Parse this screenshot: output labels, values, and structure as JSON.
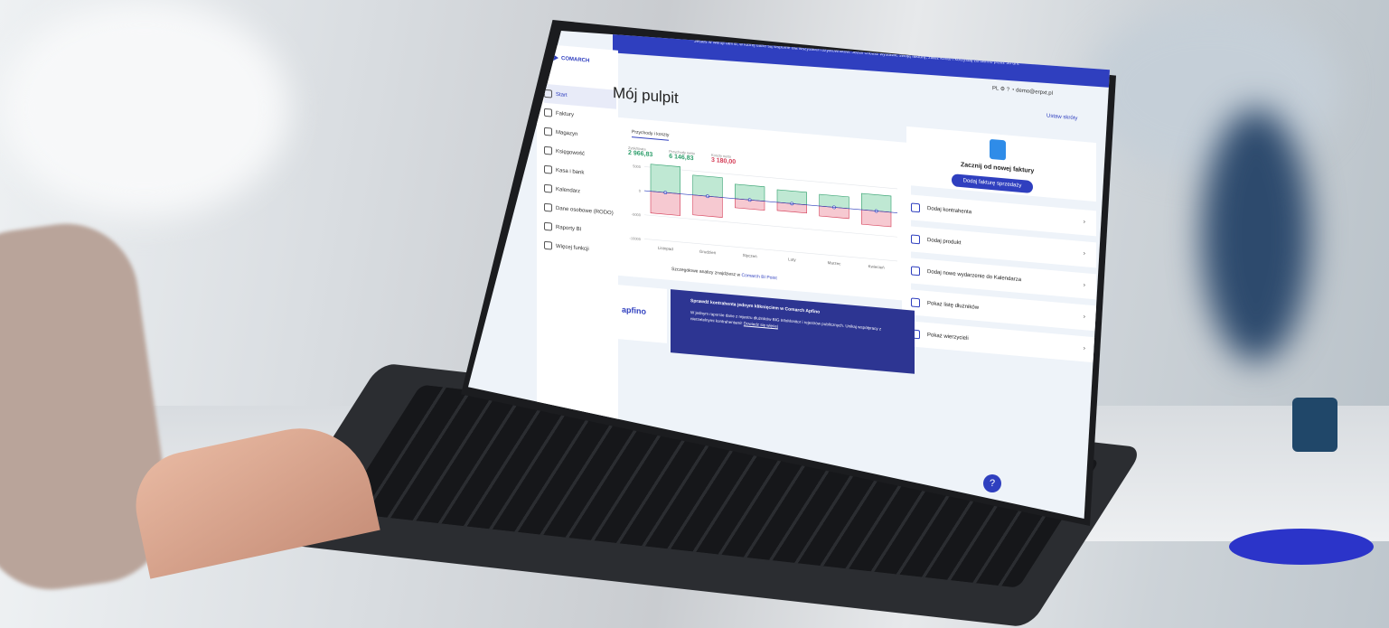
{
  "banner": {
    "text": "Jesteś w wersji demo, w której dane są wspólne dla wszystkich użytkowników. Jeżeli chcesz wystawić swoją fakturę, załóż konto i korzystaj za darmo przez 30 dni."
  },
  "app": {
    "logo_line1": "COMARCH",
    "logo_line2": "ERP XT"
  },
  "header": {
    "title": "Mój pulpit",
    "lang": "PL",
    "user": "demo@erpxt.pl",
    "set_tiles": "Ustaw skróty"
  },
  "sidebar": {
    "items": [
      {
        "label": "Start",
        "icon": "home-icon"
      },
      {
        "label": "Faktury",
        "icon": "invoice-icon"
      },
      {
        "label": "Magazyn",
        "icon": "warehouse-icon"
      },
      {
        "label": "Księgowość",
        "icon": "accounting-icon"
      },
      {
        "label": "Kasa i bank",
        "icon": "bank-icon"
      },
      {
        "label": "Kalendarz",
        "icon": "calendar-icon"
      },
      {
        "label": "Dane osobowe (RODO)",
        "icon": "person-icon"
      },
      {
        "label": "Raporty BI",
        "icon": "reports-icon"
      },
      {
        "label": "Więcej funkcji",
        "icon": "more-icon"
      }
    ]
  },
  "chart_card": {
    "tab": "Przychody i koszty",
    "kpis": [
      {
        "label": "Zysk/strata",
        "value": "2 966,83",
        "color": "#2e9e6b"
      },
      {
        "label": "Przychody netto",
        "value": "6 146,83",
        "color": "#2e9e6b"
      },
      {
        "label": "Koszty netto",
        "value": "3 180,00",
        "color": "#d43b55"
      }
    ],
    "bi_note": "Szczegółowe analizy znajdziesz w",
    "bi_link": "Comarch BI Point"
  },
  "chart_data": {
    "type": "bar",
    "categories": [
      "Listopad",
      "Grudzień",
      "Styczeń",
      "Luty",
      "Marzec",
      "Kwiecień"
    ],
    "series": [],
    "yticks": [
      "5000",
      "0",
      "-5000",
      "-10000"
    ]
  },
  "side_card": {
    "title": "Zacznij od nowej faktury",
    "button": "Dodaj fakturę sprzedaży"
  },
  "actions": [
    {
      "label": "Dodaj kontrahenta",
      "icon": "person-add-icon"
    },
    {
      "label": "Dodaj produkt",
      "icon": "box-icon"
    },
    {
      "label": "Dodaj nowe wydarzenie do Kalendarza",
      "icon": "calendar-icon"
    },
    {
      "label": "Pokaż listę dłużników",
      "icon": "group-icon"
    },
    {
      "label": "Pokaż wierzycieli",
      "icon": "group-icon"
    }
  ],
  "promo": {
    "logo": "apfino",
    "heading": "Sprawdź kontrahenta jednym kliknięciem w Comarch Apfino",
    "text": "W jednym raporcie dane z rejestru dłużników BIG InfoMonitor i rejestrów publicznych. Unikaj współpracy z nierzetelnymi kontrahentami!",
    "link": "Dowiedz się więcej"
  },
  "help": {
    "label": "?"
  }
}
